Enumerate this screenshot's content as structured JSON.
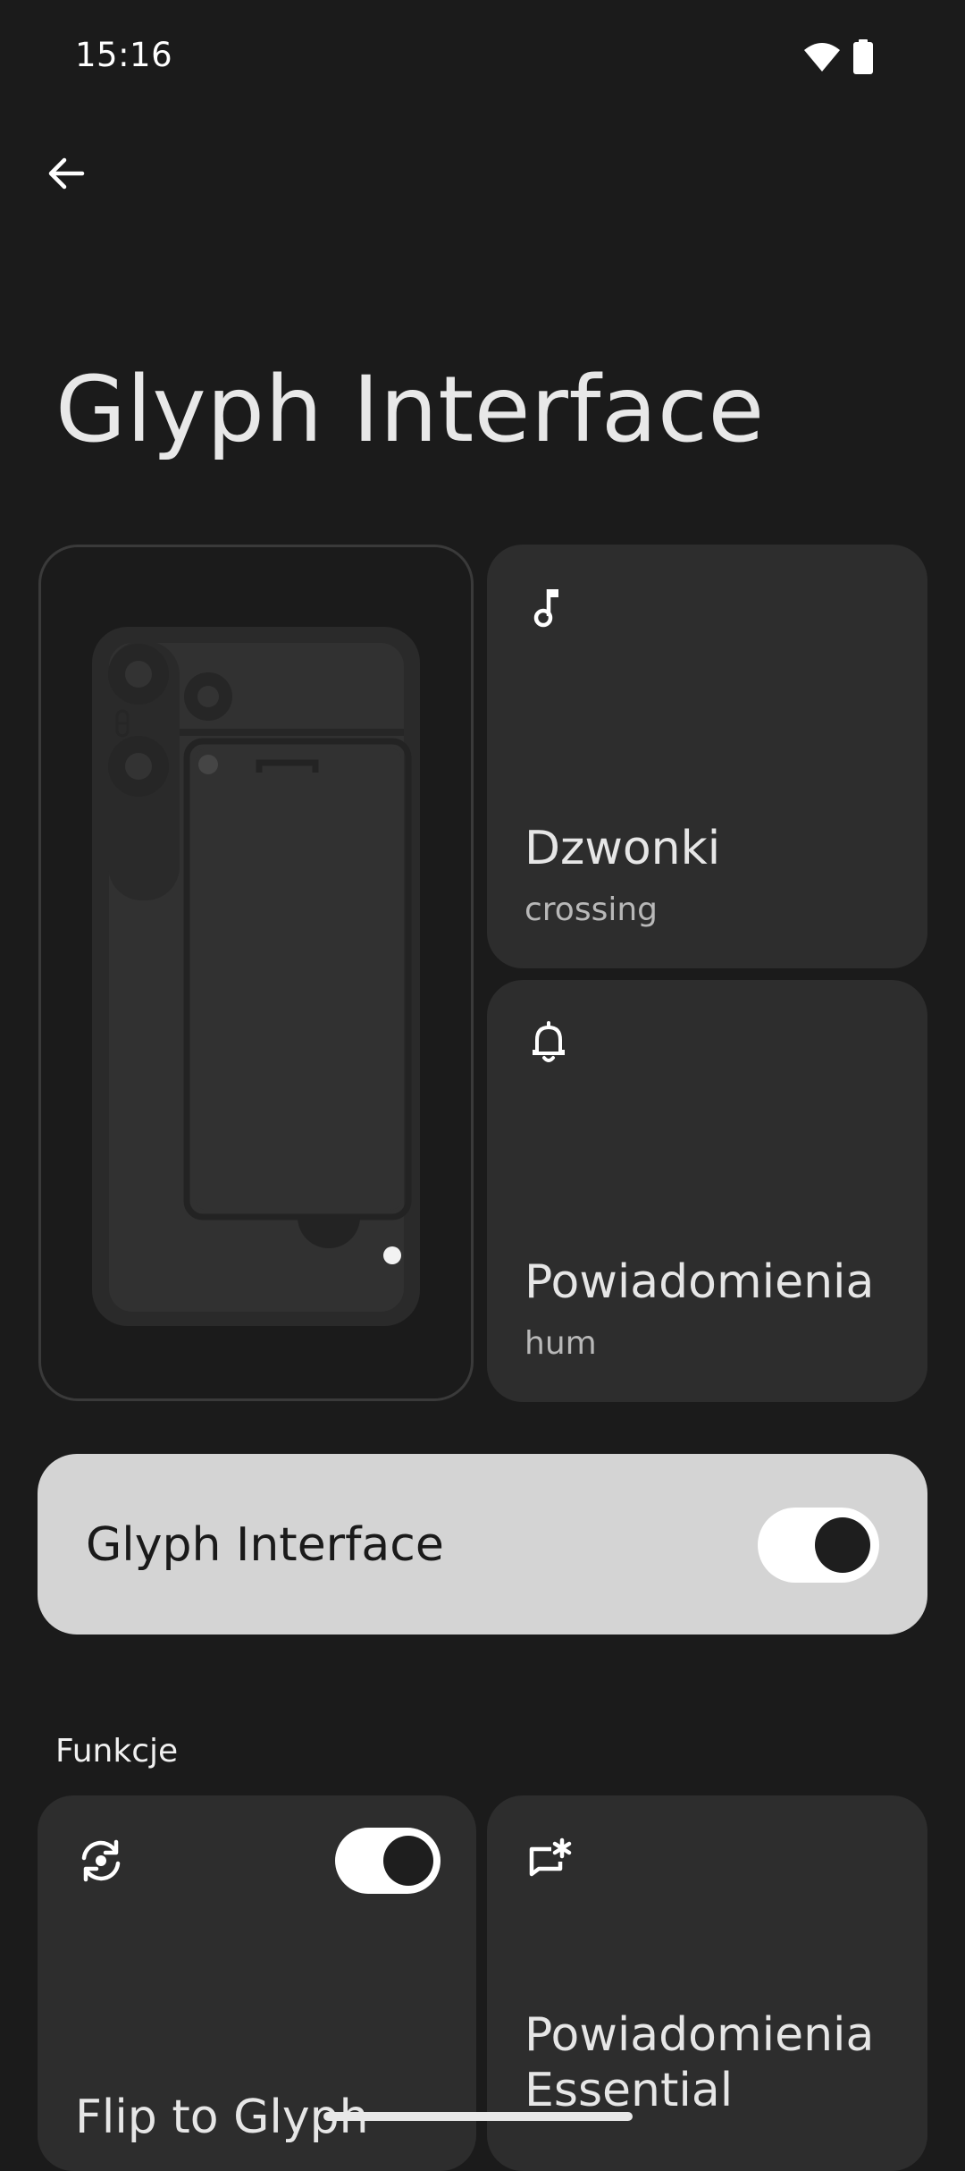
{
  "status_bar": {
    "time": "15:16",
    "icons": [
      "wifi-icon",
      "battery-icon"
    ]
  },
  "header": {
    "back_icon": "arrow-left-icon",
    "title": "Glyph Interface"
  },
  "tiles": {
    "ringtones": {
      "icon": "music-note-icon",
      "title": "Dzwonki",
      "subtitle": "crossing"
    },
    "notifications": {
      "icon": "bell-icon",
      "title": "Powiadomienia",
      "subtitle": "hum"
    }
  },
  "master_toggle": {
    "label": "Glyph Interface",
    "enabled": true
  },
  "features": {
    "section_label": "Funkcje",
    "flip": {
      "icon": "flip-rotate-icon",
      "title": "Flip to Glyph",
      "enabled": true
    },
    "essential": {
      "icon": "message-star-icon",
      "title_line1": "Powiadomienia",
      "title_line2": "Essential"
    }
  },
  "colors": {
    "background": "#1b1b1b",
    "tile": "#2d2d2d",
    "toggle_card": "#d4d4d4",
    "text_primary": "#e6e6e6",
    "text_secondary": "#b8b8b8"
  }
}
